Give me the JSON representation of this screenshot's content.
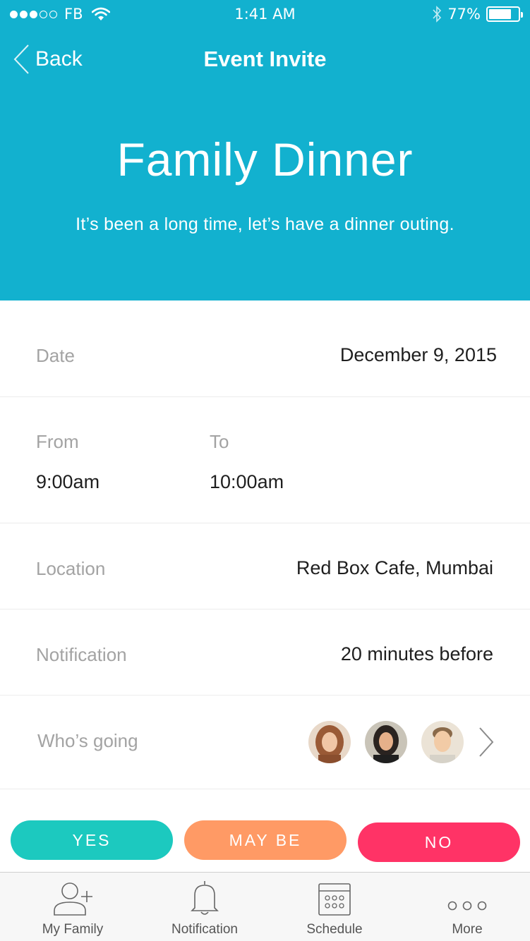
{
  "status_bar": {
    "carrier": "FB",
    "time": "1:41 AM",
    "battery": "77%",
    "battery_level": 0.77
  },
  "nav": {
    "back_label": "Back",
    "title": "Event Invite"
  },
  "event": {
    "title": "Family Dinner",
    "description": "It’s been a long time, let’s have a dinner outing."
  },
  "details": {
    "date_label": "Date",
    "date_value": "December 9, 2015",
    "from_label": "From",
    "from_value": "9:00am",
    "to_label": "To",
    "to_value": "10:00am",
    "location_label": "Location",
    "location_value": "Red Box Cafe, Mumbai",
    "notification_label": "Notification",
    "notification_value": "20 minutes before",
    "going_label": "Who’s going"
  },
  "rsvp": {
    "yes": "YES",
    "maybe": "MAY BE",
    "no": "NO"
  },
  "tabs": [
    {
      "label": "My Family",
      "icon": "add-user-icon"
    },
    {
      "label": "Notification",
      "icon": "bell-icon"
    },
    {
      "label": "Schedule",
      "icon": "calendar-icon"
    },
    {
      "label": "More",
      "icon": "more-dots-icon"
    }
  ],
  "colors": {
    "header": "#12b1cf",
    "yes": "#1cc9bf",
    "maybe": "#ff9a65",
    "no": "#ff3366"
  }
}
